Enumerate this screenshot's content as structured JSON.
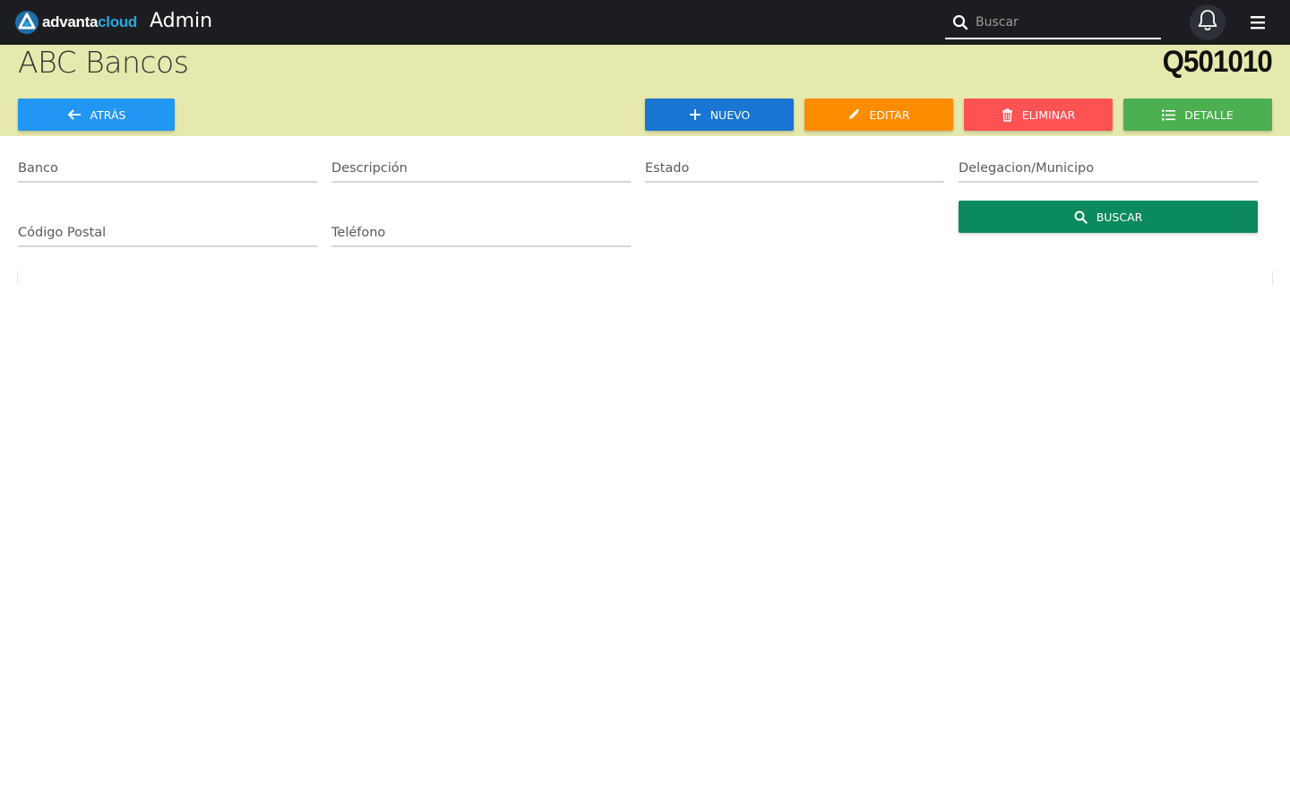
{
  "topbar": {
    "logo_prefix": "advanta",
    "logo_suffix": "cloud",
    "app_title": "Admin",
    "search_placeholder": "Buscar",
    "icons": [
      "search-icon",
      "bell-icon",
      "menu-icon"
    ]
  },
  "header": {
    "title": "ABC Bancos",
    "code": "Q501010",
    "background_color": "#e6e9ad"
  },
  "toolbar": {
    "back_label": "ATRÁS",
    "new_label": "NUEVO",
    "edit_label": "EDITAR",
    "delete_label": "ELIMINAR",
    "detail_label": "DETALLE",
    "colors": {
      "back": "#2296f3",
      "new": "#1976d2",
      "edit": "#fb8c00",
      "delete": "#ff5252",
      "detail": "#4caf50"
    }
  },
  "filters": {
    "banco": "Banco",
    "descripcion": "Descripción",
    "estado": "Estado",
    "delegacion": "Delegacion/Municipo",
    "codigo_postal": "Código Postal",
    "telefono": "Teléfono",
    "search_label": "BUSCAR",
    "search_color": "#0a8a5d"
  }
}
